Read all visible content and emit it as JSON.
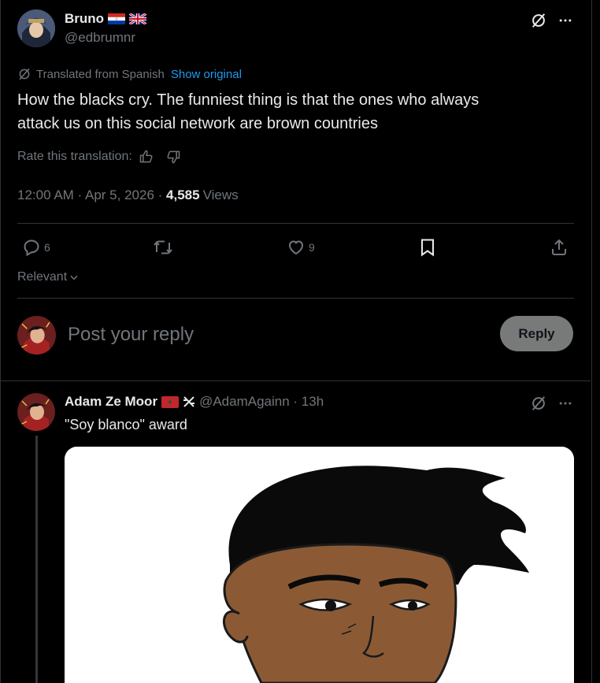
{
  "main_tweet": {
    "author_name": "Bruno",
    "author_flags": [
      "paraguay-flag-icon",
      "uk-flag-icon"
    ],
    "handle": "@edbrumnr",
    "translated_label": "Translated from Spanish",
    "show_original": "Show original",
    "text_line1": "How the blacks cry. The funniest thing is that the ones who always",
    "text_line2": "attack us on this social network are brown countries",
    "rate_label": "Rate this translation:",
    "timestamp": "12:00 AM · Apr 5, 2026 · ",
    "views_count": "4,585",
    "views_label": "Views",
    "replies": "6",
    "likes": "9"
  },
  "sort": {
    "label": "Relevant"
  },
  "composer": {
    "placeholder": "Post your reply",
    "reply_label": "Reply"
  },
  "reply": {
    "author_name": "Adam Ze Moor",
    "author_flags": [
      "morocco-flag-icon",
      "x-swords-icon"
    ],
    "handle": "@AdamAgainn",
    "time": " · 13h",
    "text": "\"Soy blanco\" award"
  },
  "colors": {
    "link": "#1d9bf0",
    "muted": "#71767b",
    "border": "#2f3336",
    "text": "#e7e9ea",
    "reply_button": "#787a7a"
  }
}
